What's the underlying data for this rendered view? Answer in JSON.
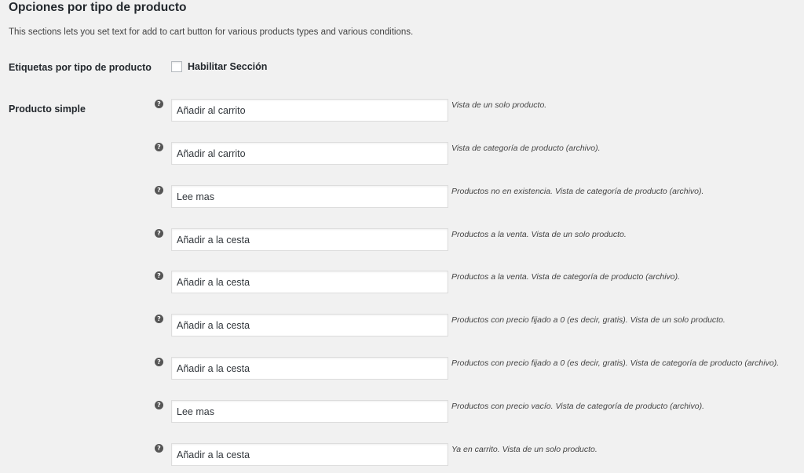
{
  "section": {
    "title": "Opciones por tipo de producto",
    "description": "This sections lets you set text for add to cart button for various products types and various conditions."
  },
  "etiquetas": {
    "label": "Etiquetas por tipo de producto",
    "checkbox_label": "Habilitar Sección",
    "checked": false
  },
  "simple": {
    "label": "Producto simple",
    "help_icon": "question-mark",
    "fields": [
      {
        "value": "Añadir al carrito",
        "description": "Vista de un solo producto."
      },
      {
        "value": "Añadir al carrito",
        "description": "Vista de categoría de producto (archivo)."
      },
      {
        "value": "Lee mas",
        "description": "Productos no en existencia. Vista de categoría de producto (archivo)."
      },
      {
        "value": "Añadir a la cesta",
        "description": "Productos a la venta. Vista de un solo producto."
      },
      {
        "value": "Añadir a la cesta",
        "description": "Productos a la venta. Vista de categoría de producto (archivo)."
      },
      {
        "value": "Añadir a la cesta",
        "description": "Productos con precio fijado a 0 (es decir, gratis). Vista de un solo producto."
      },
      {
        "value": "Añadir a la cesta",
        "description": "Productos con precio fijado a 0 (es decir, gratis). Vista de categoría de producto (archivo)."
      },
      {
        "value": "Lee mas",
        "description": "Productos con precio vacío. Vista de categoría de producto (archivo)."
      },
      {
        "value": "Añadir a la cesta",
        "description": "Ya en carrito. Vista de un solo producto."
      }
    ]
  }
}
